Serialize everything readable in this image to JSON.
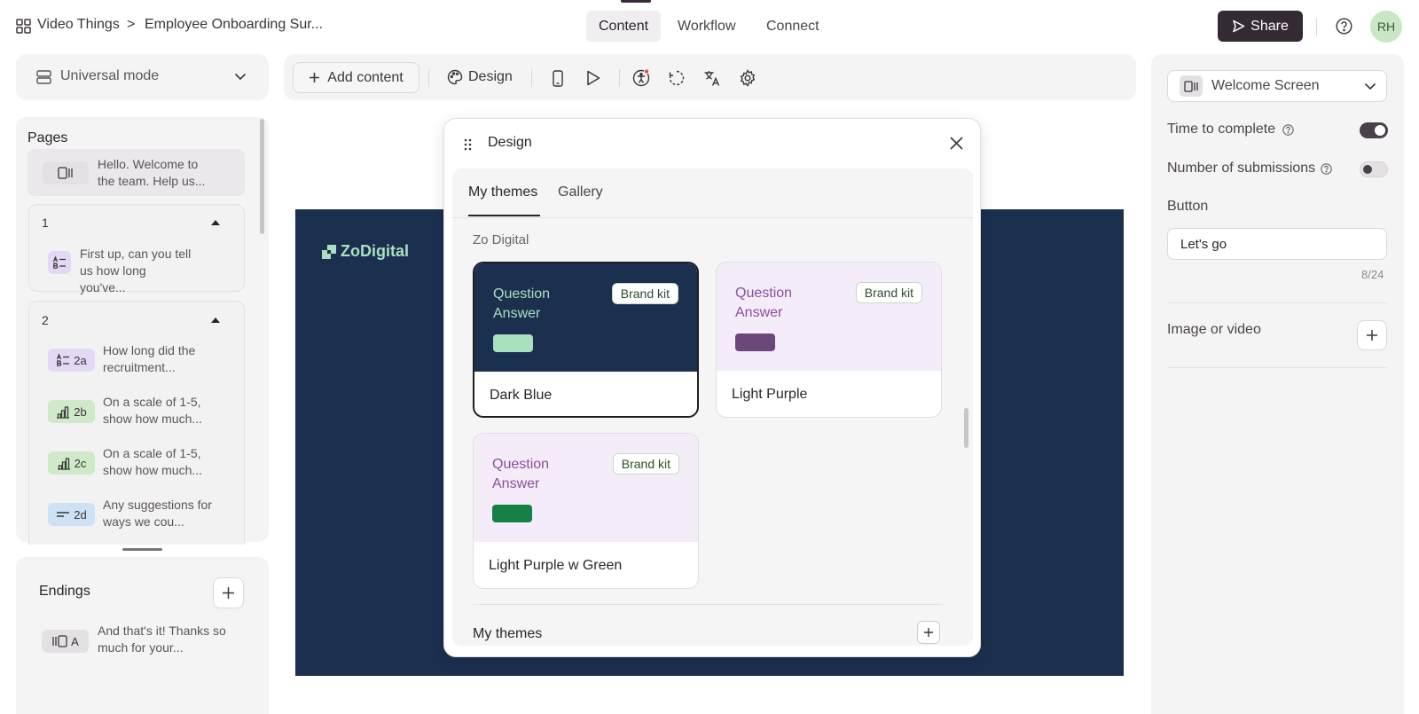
{
  "breadcrumb": {
    "workspace": "Video Things",
    "separator": ">",
    "survey": "Employee Onboarding Sur..."
  },
  "top_tabs": [
    "Content",
    "Workflow",
    "Connect"
  ],
  "share_label": "Share",
  "avatar_initials": "RH",
  "mode_select": "Universal mode",
  "toolbar": {
    "add_content": "Add content",
    "design": "Design"
  },
  "pages": {
    "title": "Pages",
    "welcome": "Hello. Welcome to the team. Help us...",
    "groups": [
      {
        "number": "1",
        "items": [
          {
            "text": "First up, can you tell us how long you've..."
          }
        ]
      },
      {
        "number": "2",
        "items": [
          {
            "badge": "2a",
            "text": "How long did the recruitment..."
          },
          {
            "badge": "2b",
            "text": "On a scale of 1-5, show how much..."
          },
          {
            "badge": "2c",
            "text": "On a scale of 1-5, show how much..."
          },
          {
            "badge": "2d",
            "text": "Any suggestions for ways we cou..."
          }
        ]
      }
    ]
  },
  "endings": {
    "title": "Endings",
    "item_badge": "A",
    "item_text": "And that's it! Thanks so much for your..."
  },
  "canvas": {
    "logo": "ZoDigital",
    "background": "#1b2f4e"
  },
  "design": {
    "title": "Design",
    "tabs": [
      "My themes",
      "Gallery"
    ],
    "section": "Zo Digital",
    "themes": [
      {
        "question": "Question",
        "answer": "Answer",
        "badge": "Brand kit",
        "name": "Dark Blue",
        "bg": "#1b2f4e",
        "text_color": "#a8e0c0",
        "swatch": "#a8e0c0",
        "selected": true
      },
      {
        "question": "Question",
        "answer": "Answer",
        "badge": "Brand kit",
        "name": "Light Purple",
        "bg": "#f5ecfa",
        "text_color": "#8a4f9a",
        "swatch": "#6b4877",
        "selected": false
      },
      {
        "question": "Question",
        "answer": "Answer",
        "badge": "Brand kit",
        "name": "Light Purple w Green",
        "bg": "#f5ecfa",
        "text_color": "#8a4f9a",
        "swatch": "#168045",
        "selected": false
      }
    ],
    "my_themes_label": "My themes"
  },
  "right_panel": {
    "screen_select": "Welcome Screen",
    "time_to_complete": {
      "label": "Time to complete",
      "on": true
    },
    "number_of_submissions": {
      "label": "Number of submissions",
      "on": false
    },
    "button_label": "Button",
    "button_value": "Let's go",
    "char_count": "8/24",
    "image_or_video": "Image or video"
  },
  "colors": {
    "accent": "#332a33",
    "panel": "#f5f4f5",
    "canvas": "#1b2f4e"
  }
}
